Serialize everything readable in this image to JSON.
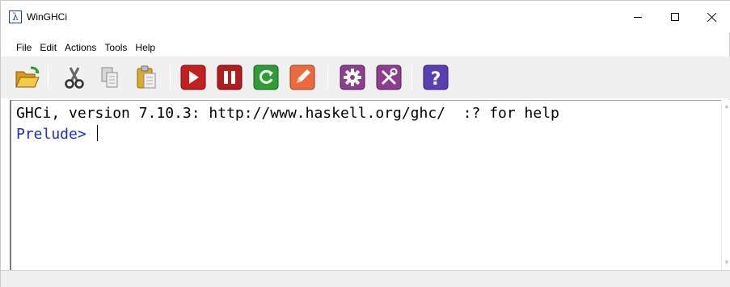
{
  "window": {
    "title": "WinGHCi",
    "app_icon_glyph": "λ"
  },
  "menu": [
    "File",
    "Edit",
    "Actions",
    "Tools",
    "Help"
  ],
  "toolbar": {
    "buttons": [
      {
        "name": "open-icon",
        "color": "#e8a317"
      },
      {
        "name": "cut-icon",
        "color": "#555555"
      },
      {
        "name": "copy-icon",
        "color": "#9a9a9a"
      },
      {
        "name": "paste-icon",
        "color": "#d7a21b"
      },
      {
        "name": "run-icon",
        "color": "#c21d1d"
      },
      {
        "name": "pause-icon",
        "color": "#b21c1c"
      },
      {
        "name": "reload-icon",
        "color": "#2e9b2e"
      },
      {
        "name": "edit-icon",
        "color": "#e8603c"
      },
      {
        "name": "settings-icon",
        "color": "#8e3d8e"
      },
      {
        "name": "tools-icon",
        "color": "#8e3d8e"
      },
      {
        "name": "help-icon",
        "color": "#5b3fb0"
      }
    ]
  },
  "console": {
    "banner": "GHCi, version 7.10.3: http://www.haskell.org/ghc/  :? for help",
    "prompt": "Prelude> "
  },
  "colors": {
    "prompt": "#1a2fb8",
    "toolbar_bg": "#f0f0f0"
  }
}
